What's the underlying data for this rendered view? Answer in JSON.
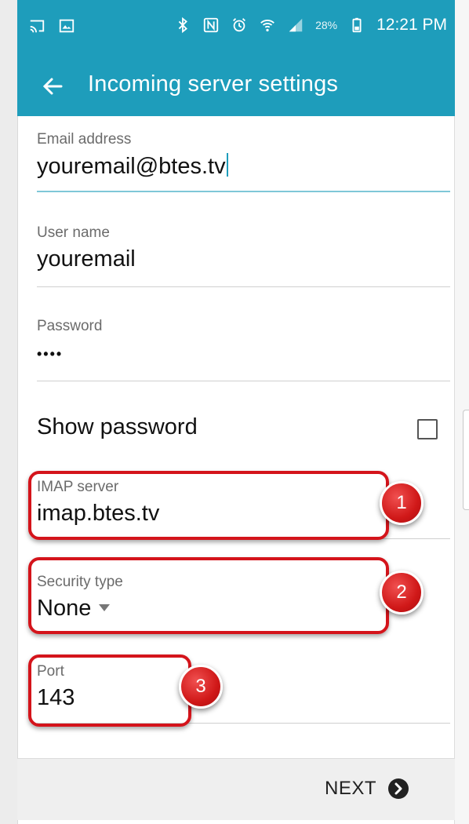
{
  "status_bar": {
    "battery_percent": "28%",
    "time": "12:21 PM",
    "icons": [
      "cast-icon",
      "image-icon",
      "bluetooth-icon",
      "nfc-icon",
      "alarm-icon",
      "wifi-icon",
      "signal-icon",
      "battery-icon"
    ]
  },
  "app_bar": {
    "title": "Incoming server settings",
    "back_icon": "arrow-back-icon"
  },
  "form": {
    "email": {
      "label": "Email address",
      "value": "youremail@btes.tv"
    },
    "username": {
      "label": "User name",
      "value": "youremail"
    },
    "password": {
      "label": "Password",
      "value": "••••"
    },
    "show_password": {
      "label": "Show password",
      "checked": false
    },
    "imap_server": {
      "label": "IMAP server",
      "value": "imap.btes.tv",
      "callout": "1"
    },
    "security_type": {
      "label": "Security type",
      "value": "None",
      "callout": "2"
    },
    "port": {
      "label": "Port",
      "value": "143",
      "callout": "3"
    }
  },
  "footer": {
    "next_label": "NEXT",
    "next_icon": "chevron-circle-right-icon"
  },
  "colors": {
    "accent": "#1e9dbb",
    "callout_red": "#d4141b"
  }
}
